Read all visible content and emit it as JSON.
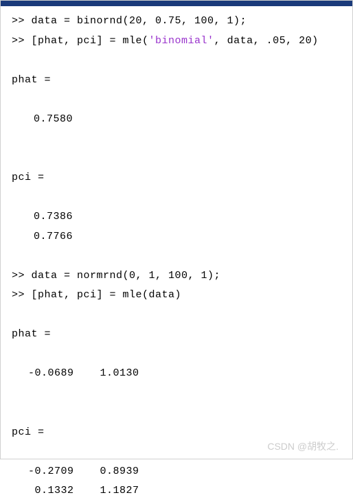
{
  "lines": {
    "l1_prompt": ">> ",
    "l1_code": "data = binornd(20, 0.75, 100, 1);",
    "l2_prompt": ">> ",
    "l2a": "[phat, pci] = mle(",
    "l2_str": "'binomial'",
    "l2b": ", data, .05, 20)",
    "phat_label1": "phat =",
    "phat_val1": "0.7580",
    "pci_label1": "pci =",
    "pci_val1a": "0.7386",
    "pci_val1b": "0.7766",
    "l3_prompt": ">> ",
    "l3_code": "data = normrnd(0, 1, 100, 1);",
    "l4_prompt": ">> ",
    "l4_code": "[phat, pci] = mle(data)",
    "phat_label2": "phat =",
    "phat_val2": "-0.0689    1.0130",
    "pci_label2": "pci =",
    "pci_val2a": "-0.2709    0.8939",
    "pci_val2b": " 0.1332    1.1827"
  },
  "watermark": "CSDN @胡牧之."
}
